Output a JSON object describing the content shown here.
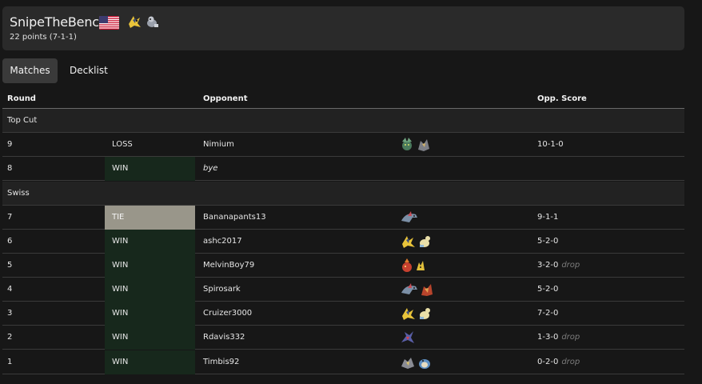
{
  "player": {
    "name": "SnipeTheBench",
    "points": "22 points (7-1-1)",
    "country_flag_icon": "flag-united-states-icon",
    "deck_icons": [
      "pokemon-sprite-yellow-icon",
      "pokemon-sprite-grey-icon"
    ]
  },
  "tabs": [
    {
      "label": "Matches",
      "active": true
    },
    {
      "label": "Decklist",
      "active": false
    }
  ],
  "table": {
    "headers": {
      "round": "Round",
      "opponent": "Opponent",
      "opp_score": "Opp. Score"
    },
    "sections": [
      {
        "label": "Top Cut",
        "rows": [
          {
            "round": "9",
            "result": "LOSS",
            "opponent": "Nimium",
            "deck": [
              "green-pokemon-sprite",
              "grey-pokemon-sprite"
            ],
            "score": "10-1-0",
            "drop": ""
          },
          {
            "round": "8",
            "result": "WIN",
            "opponent": "bye",
            "deck": [],
            "score": "",
            "drop": ""
          }
        ]
      },
      {
        "label": "Swiss",
        "rows": [
          {
            "round": "7",
            "result": "TIE",
            "opponent": "Bananapants13",
            "deck": [
              "dragon-pokemon-sprite"
            ],
            "score": "9-1-1",
            "drop": ""
          },
          {
            "round": "6",
            "result": "WIN",
            "opponent": "ashc2017",
            "deck": [
              "yellow-pokemon-sprite",
              "cream-pokemon-sprite"
            ],
            "score": "5-2-0",
            "drop": ""
          },
          {
            "round": "5",
            "result": "WIN",
            "opponent": "MelvinBoy79",
            "deck": [
              "red-pokemon-sprite",
              "yellow-small-pokemon-sprite"
            ],
            "score": "3-2-0",
            "drop": "drop"
          },
          {
            "round": "4",
            "result": "WIN",
            "opponent": "Spirosark",
            "deck": [
              "dragon-pokemon-sprite",
              "red-orange-pokemon-sprite"
            ],
            "score": "5-2-0",
            "drop": ""
          },
          {
            "round": "3",
            "result": "WIN",
            "opponent": "Cruizer3000",
            "deck": [
              "yellow-pokemon-sprite",
              "cream-pokemon-sprite"
            ],
            "score": "7-2-0",
            "drop": ""
          },
          {
            "round": "2",
            "result": "WIN",
            "opponent": "Rdavis332",
            "deck": [
              "purple-pokemon-sprite"
            ],
            "score": "1-3-0",
            "drop": "drop"
          },
          {
            "round": "1",
            "result": "WIN",
            "opponent": "Timbis92",
            "deck": [
              "grey-pokemon-sprite",
              "blue-pokemon-sprite"
            ],
            "score": "0-2-0",
            "drop": "drop"
          }
        ]
      }
    ]
  },
  "colors": {
    "background": "#171717",
    "card": "#2a2a2a",
    "win_cell": "#17281c",
    "tie_cell": "#99968a",
    "drop_text": "#7a7a7a"
  }
}
